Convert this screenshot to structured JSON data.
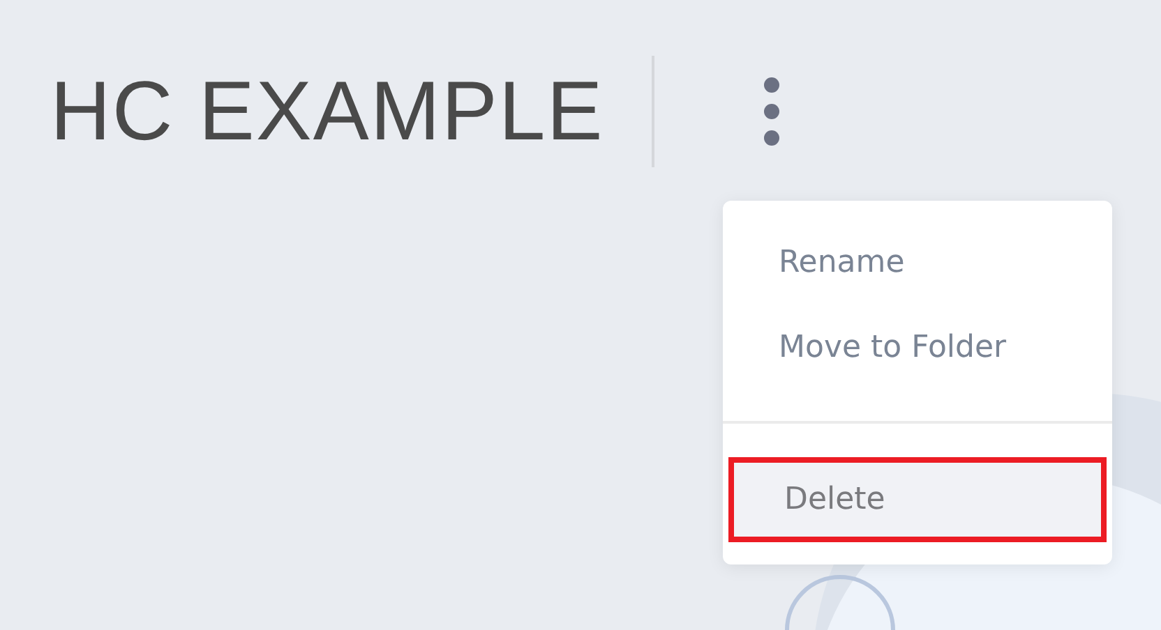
{
  "header": {
    "title": "HC EXAMPLE"
  },
  "menu": {
    "groups": [
      {
        "items": [
          {
            "label": "Rename",
            "highlighted": false
          },
          {
            "label": "Move to Folder",
            "highlighted": false
          }
        ]
      },
      {
        "items": [
          {
            "label": "Delete",
            "highlighted": true
          }
        ]
      }
    ]
  }
}
